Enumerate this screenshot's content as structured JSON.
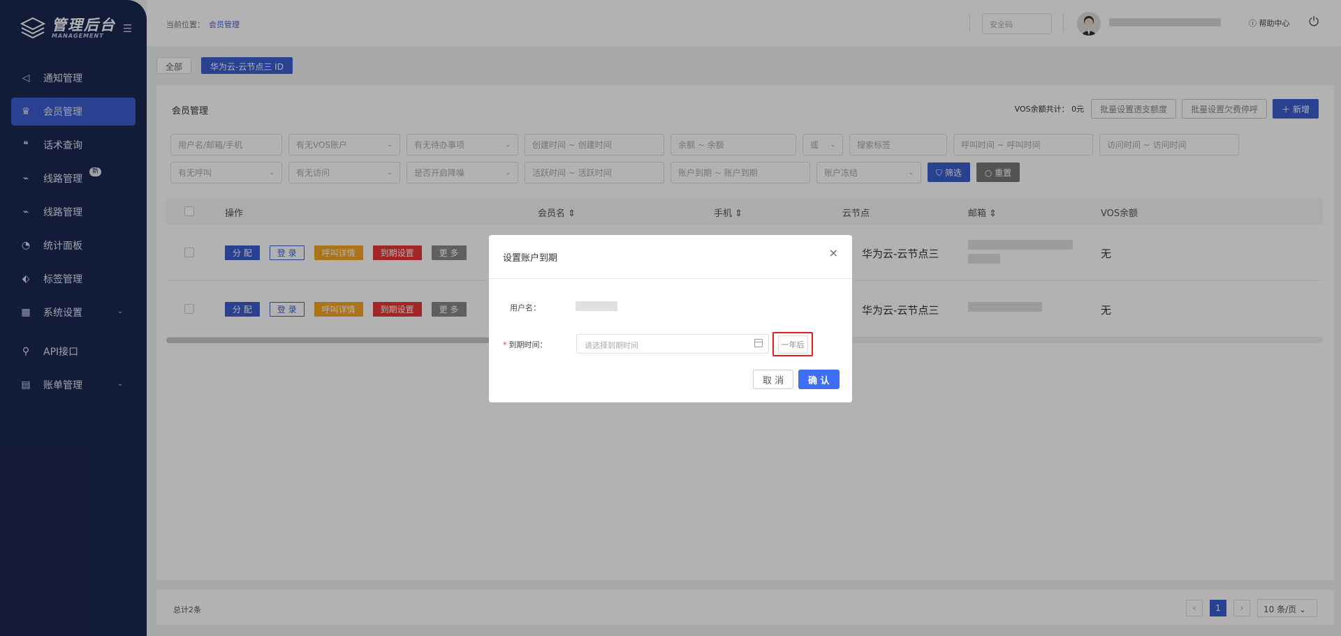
{
  "sidebar": {
    "logo_title": "管理后台",
    "logo_sub": "MANAGEMENT",
    "items": [
      {
        "label": "通知管理",
        "icon": "speaker-icon",
        "glyph": "◁"
      },
      {
        "label": "会员管理",
        "icon": "crown-icon",
        "glyph": "♛"
      },
      {
        "label": "话术查询",
        "icon": "quote-icon",
        "glyph": "❝"
      },
      {
        "label": "线路管理",
        "icon": "pulse-icon",
        "glyph": "⌁",
        "badge": "新"
      },
      {
        "label": "线路管理",
        "icon": "pulse-icon",
        "glyph": "⌁"
      },
      {
        "label": "统计面板",
        "icon": "pie-chart-icon",
        "glyph": "◔"
      },
      {
        "label": "标签管理",
        "icon": "tag-icon",
        "glyph": "⬖"
      },
      {
        "label": "系统设置",
        "icon": "grid-icon",
        "glyph": "▦",
        "arrow": "⌄"
      },
      {
        "label": "API接口",
        "icon": "key-icon",
        "glyph": "⚲"
      },
      {
        "label": "账单管理",
        "icon": "bill-icon",
        "glyph": "▤",
        "arrow": "⌄"
      }
    ]
  },
  "topbar": {
    "crumb_label": "当前位置：",
    "crumb_current": "会员管理",
    "safe_placeholder": "安全码",
    "help": "帮助中心"
  },
  "tabs": [
    "全部",
    "华为云-云节点三  ID"
  ],
  "card": {
    "title": "会员管理",
    "vos_total": "VOS余额共计：  0元",
    "batch_limit": "批量设置透支额度",
    "batch_stop": "批量设置欠费停呼",
    "add": "＋ 新增"
  },
  "filters": {
    "row1": [
      {
        "text": "用户名/邮箱/手机",
        "w": 160
      },
      {
        "text": "有无VOS账户",
        "arr": "⌄",
        "w": 160
      },
      {
        "text": "有无待办事项",
        "arr": "⌄",
        "w": 160
      },
      {
        "text": "创建时间   ~   创建时间",
        "w": 200
      },
      {
        "text": "余额      ~     余额",
        "w": 180
      },
      {
        "text": "或",
        "arr": "⌄",
        "w": 58
      },
      {
        "text": "搜索标签",
        "w": 140
      },
      {
        "text": "呼叫时间   ~   呼叫时间",
        "w": 200
      },
      {
        "text": "访问时间   ~   访问时间",
        "w": 200
      }
    ],
    "row2": [
      {
        "text": "有无呼叫",
        "arr": "⌄",
        "w": 160
      },
      {
        "text": "有无访问",
        "arr": "⌄",
        "w": 160
      },
      {
        "text": "是否开启降噪",
        "arr": "⌄",
        "w": 160
      },
      {
        "text": "活跃时间   ~   活跃时间",
        "w": 200
      },
      {
        "text": "账户到期   ~   账户到期",
        "w": 200
      },
      {
        "text": "账户冻结",
        "arr": "⌄",
        "w": 150
      }
    ],
    "filter_btn": "⛉ 筛选",
    "reset_btn": "○ 重置"
  },
  "table": {
    "headers": {
      "ops": "操作",
      "member": "会员名 ⇕",
      "phone": "手机 ⇕",
      "node": "云节点",
      "email": "邮箱 ⇕",
      "vos": "VOS余额"
    },
    "ops": [
      "分 配",
      "登 录",
      "呼叫详情",
      "到期设置",
      "更 多"
    ],
    "rows": [
      {
        "node": "华为云-云节点三",
        "vos": "无"
      },
      {
        "node": "华为云-云节点三",
        "vos": "无"
      }
    ]
  },
  "footer": {
    "total": "总计2条",
    "page": "1",
    "page_size": "10 条/页 ⌄",
    "prev": "‹",
    "next": "›"
  },
  "modal": {
    "title": "设置账户到期",
    "close": "×",
    "username_label": "用户名：",
    "expire_label": "到期时间：",
    "required": "*",
    "date_placeholder": "请选择到期时间",
    "one_year": "一年后",
    "cancel": "取 消",
    "confirm": "确 认"
  },
  "colors": {
    "primary": "#3d5ed0",
    "sidebar": "#1b2751",
    "danger": "#e53935",
    "warning": "#f5a623"
  }
}
